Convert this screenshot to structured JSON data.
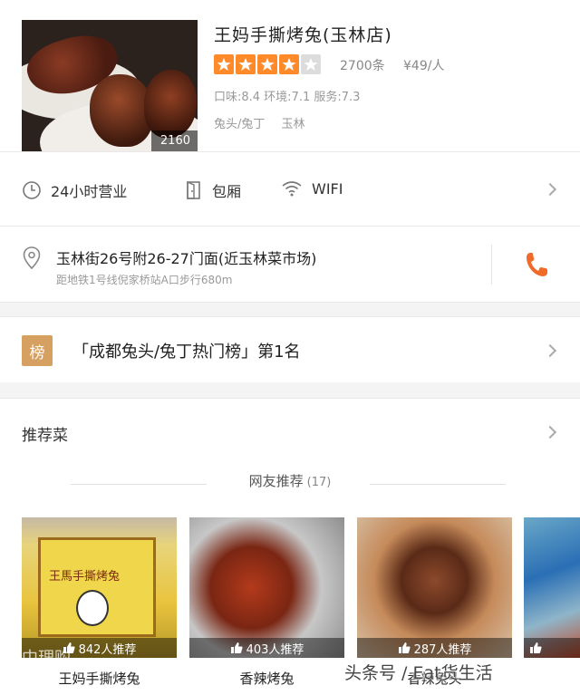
{
  "shop": {
    "name": "王妈手撕烤兔(玉林店)",
    "photo_count": "2160",
    "rating_stars": 4,
    "rating_max": 5,
    "reviews": "2700条",
    "price": "¥49/人",
    "scores": "口味:8.4  环境:7.1  服务:7.3",
    "tags": [
      "兔头/兔丁",
      "玉林"
    ]
  },
  "amenities": {
    "hours": "24小时营业",
    "room": "包厢",
    "wifi": "WIFI"
  },
  "address": {
    "main": "玉林街26号附26-27门面(近玉林菜市场)",
    "sub": "距地铁1号线倪家桥站A口步行680m"
  },
  "ranking": {
    "badge": "榜",
    "text": "「成都兔头/兔丁热门榜」第1名"
  },
  "recommend": {
    "title": "推荐菜",
    "section_label": "网友推荐",
    "section_count": "(17)"
  },
  "dishes": [
    {
      "name": "王妈手撕烤兔",
      "likes": "842人推荐",
      "box_label": "王馬手撕烤兔"
    },
    {
      "name": "香辣烤兔",
      "likes": "403人推荐"
    },
    {
      "name": "香辣兔头",
      "likes": "287人推荐"
    },
    {
      "name": "",
      "likes": ""
    }
  ],
  "watermark": "头条号 / Eat货生活",
  "watermark2": "中理购",
  "colors": {
    "star_on": "#ff8a2a",
    "star_off": "#dcdcdc",
    "phone": "#f06a2a",
    "rank_badge": "#d6a060"
  }
}
